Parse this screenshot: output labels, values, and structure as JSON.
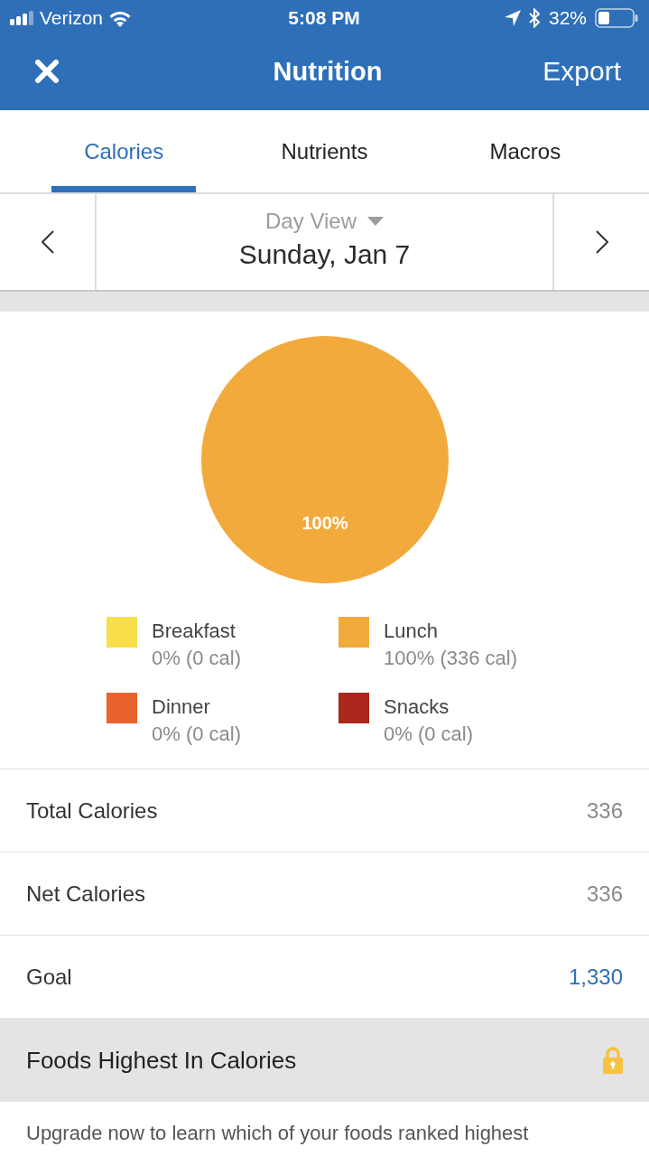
{
  "status_bar": {
    "carrier": "Verizon",
    "time": "5:08 PM",
    "battery": "32%"
  },
  "nav_bar": {
    "title": "Nutrition",
    "action": "Export"
  },
  "tabs": [
    {
      "label": "Calories",
      "selected": true
    },
    {
      "label": "Nutrients",
      "selected": false
    },
    {
      "label": "Macros",
      "selected": false
    }
  ],
  "date_nav": {
    "view": "Day View",
    "date": "Sunday, Jan 7"
  },
  "chart": {
    "chart_data": {
      "type": "pie",
      "categories": [
        "Breakfast",
        "Lunch",
        "Dinner",
        "Snacks"
      ],
      "values": [
        0,
        100,
        0,
        0
      ],
      "value_labels": [
        null,
        "100%",
        null,
        null
      ]
    },
    "legend": [
      {
        "detail": "0% (0 cal)",
        "color": "#f8de4a"
      },
      {
        "detail": "100% (336 cal)",
        "color": "#f2aa3c"
      },
      {
        "detail": "0% (0 cal)",
        "color": "#e8632d"
      },
      {
        "detail": "0% (0 cal)",
        "color": "#ab261b"
      }
    ]
  },
  "summary": [
    {
      "kind": "stat",
      "label": "Total Calories",
      "value": "336"
    },
    {
      "kind": "stat",
      "label": "Net Calories",
      "value": "336"
    },
    {
      "kind": "goal",
      "label": "Goal",
      "value": "1,330"
    }
  ],
  "section": {
    "title": "Foods Highest In Calories",
    "locked": true,
    "message": "Upgrade now to learn which of your foods ranked highest"
  }
}
